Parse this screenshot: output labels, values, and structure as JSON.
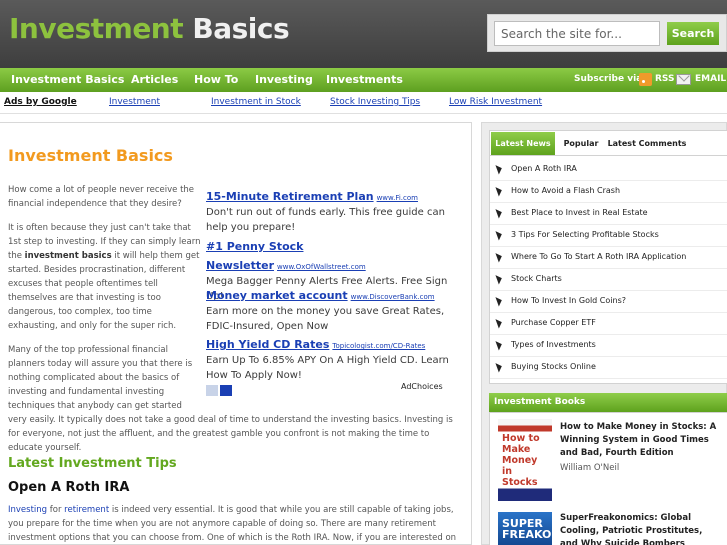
{
  "header": {
    "logo_part1": "Investment",
    "logo_part2": "Basics",
    "search_placeholder": "Search the site for...",
    "search_button": "Search"
  },
  "nav": {
    "items": [
      "Investment Basics",
      "Articles",
      "How To",
      "Investing",
      "Investments"
    ],
    "subscribe_label": "Subscribe via:",
    "rss_label": "RSS",
    "email_label": "EMAIL"
  },
  "adsbar": {
    "ads_by": "Ads by Google",
    "links": [
      "Investment",
      "Investment in Stock",
      "Stock Investing Tips",
      "Low Risk Investment"
    ]
  },
  "main": {
    "title": "Investment Basics",
    "intro_p1": "How come a lot of people never receive the financial independence that they desire?",
    "intro_p2_a": "It is often because they just can't take that 1st step to investing. If they can simply learn the ",
    "intro_p2_bold": "investment basics",
    "intro_p2_b": " it will help them get started. Besides procrastination, different excuses that people oftentimes tell themselves are that investing is too dangerous, too complex, too time exhausting, and only for the super rich.",
    "intro_p3": "Many of the top professional financial planners today will assure you that there is nothing complicated about the basics of investing and fundamental investing techniques that anybody can get started very easily. It typically does not take a good deal of time to understand the investing basics. Investing is for everyone, not just the affluent, and the greatest gamble you confront is not making the time to educate yourself.",
    "ads": [
      {
        "title": "15-Minute Retirement Plan",
        "url": "www.Fi.com",
        "desc": "Don't run out of funds early. This free guide can help you prepare!"
      },
      {
        "title": "#1 Penny Stock Newsletter",
        "url": "www.OxOfWallstreet.com",
        "desc": "Mega Bagger Penny Alerts Free Alerts. Free Sign Up!"
      },
      {
        "title": "Money market account",
        "url": "www.DiscoverBank.com",
        "desc": "Earn more on the money you save Great Rates, FDIC-Insured, Open Now"
      },
      {
        "title": "High Yield CD Rates",
        "url": "Topicologist.com/CD-Rates",
        "desc": "Earn Up To 6.85% APY On A High Yield CD. Learn How To Apply Now!"
      }
    ],
    "adchoices": "AdChoices",
    "tips_title": "Latest Investment Tips",
    "post_title": "Open A Roth IRA",
    "post_link1": "Investing",
    "post_word_for": " for ",
    "post_link2": "retirement",
    "post_text": " is indeed very essential. It is good that while you are still capable of taking jobs, you prepare for the time when you are not anymore capable of doing so. There are many retirement investment options that you can choose from. One of which is the Roth IRA. Now, if you are interested on this new type of"
  },
  "sidebar": {
    "tabs": [
      "Latest News",
      "Popular",
      "Latest Comments"
    ],
    "news": [
      "Open A Roth IRA",
      "How to Avoid a Flash Crash",
      "Best Place to Invest in Real Estate",
      "3 Tips For Selecting Profitable Stocks",
      "Where To Go To Start A Roth IRA Application",
      "Stock Charts",
      "How To Invest In Gold Coins?",
      "Purchase Copper ETF",
      "Types of Investments",
      "Buying Stocks Online"
    ],
    "books_title": "Investment Books",
    "books": [
      {
        "cover": "How to Make Money in Stocks",
        "title": "How to Make Money in Stocks: A Winning System in Good Times and Bad, Fourth Edition",
        "author": "William O'Neil"
      },
      {
        "cover": "SUPER FREAKONOMICS",
        "title": "SuperFreakonomics: Global Cooling, Patriotic Prostitutes, and Why Suicide Bombers",
        "author": ""
      }
    ]
  },
  "colors": {
    "accent_green": "#6cb32a",
    "title_orange": "#f29a1f",
    "link_blue": "#1a3fb4"
  }
}
